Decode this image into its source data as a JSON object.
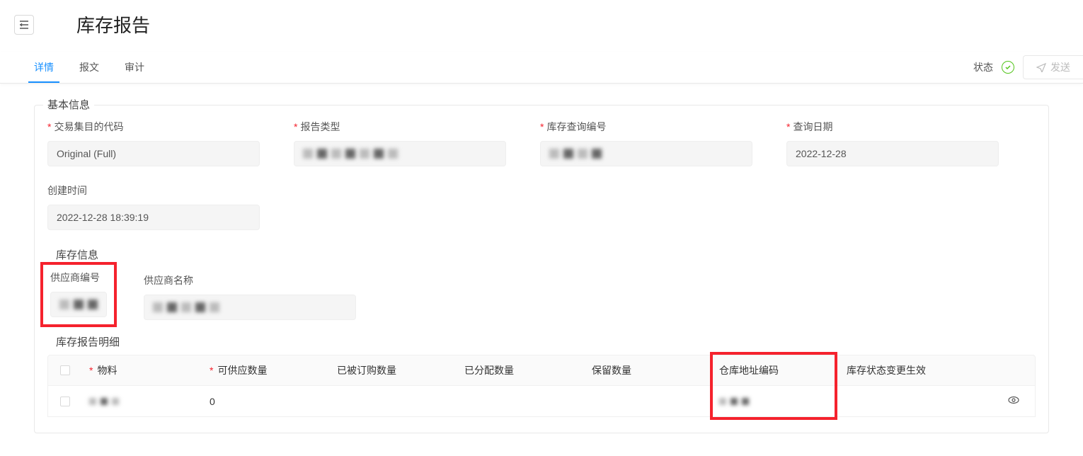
{
  "header": {
    "title": "库存报告"
  },
  "tabs": {
    "detail": "详情",
    "message": "报文",
    "audit": "审计"
  },
  "status": {
    "label": "状态"
  },
  "actions": {
    "send": "发送"
  },
  "sections": {
    "basic_info": "基本信息",
    "inventory_info": "库存信息",
    "inventory_detail": "库存报告明细"
  },
  "basic": {
    "txn_code_label": "交易集目的代码",
    "txn_code_value": "Original (Full)",
    "report_type_label": "报告类型",
    "report_type_value": "██████████",
    "inquiry_no_label": "库存查询编号",
    "inquiry_no_value": "██████",
    "inquiry_date_label": "查询日期",
    "inquiry_date_value": "2022-12-28",
    "created_label": "创建时间",
    "created_value": "2022-12-28 18:39:19"
  },
  "inventory": {
    "supplier_no_label": "供应商编号",
    "supplier_no_value": "███",
    "supplier_name_label": "供应商名称",
    "supplier_name_value": "██████"
  },
  "table": {
    "headers": {
      "material": "物料",
      "available_qty": "可供应数量",
      "ordered_qty": "已被订购数量",
      "distributed_qty": "已分配数量",
      "reserved_qty": "保留数量",
      "warehouse_addr": "仓库地址编码",
      "status_change": "库存状态变更生效"
    },
    "rows": [
      {
        "material": "███",
        "available_qty": "0",
        "ordered_qty": "",
        "distributed_qty": "",
        "reserved_qty": "",
        "warehouse_addr": "███",
        "status_change": ""
      }
    ]
  }
}
